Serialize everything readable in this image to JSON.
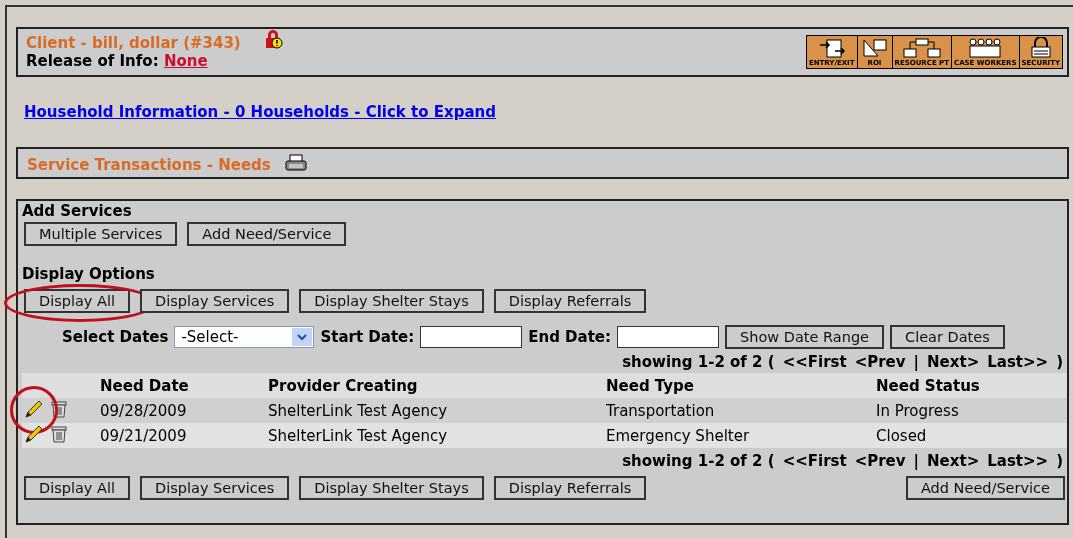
{
  "client": {
    "title": "Client - bill, dollar (#343)",
    "release_label": "Release of Info:",
    "release_value": "None"
  },
  "toolbar": [
    {
      "label": "ENTRY/EXIT",
      "kind": "entry"
    },
    {
      "label": "ROI",
      "kind": "roi"
    },
    {
      "label": "RESOURCE PT",
      "kind": "resource"
    },
    {
      "label": "CASE WORKERS",
      "kind": "workers"
    },
    {
      "label": "SECURITY",
      "kind": "security"
    }
  ],
  "household_link": "Household Information - 0 Households - Click to Expand",
  "section_title": "Service Transactions - Needs",
  "add_services": {
    "heading": "Add Services",
    "buttons": [
      "Multiple Services",
      "Add Need/Service"
    ]
  },
  "display_options": {
    "heading": "Display Options",
    "buttons": [
      {
        "label": "Display All",
        "circled": true
      },
      {
        "label": "Display Services",
        "circled": false
      },
      {
        "label": "Display Shelter Stays",
        "circled": false
      },
      {
        "label": "Display Referrals",
        "circled": false
      }
    ]
  },
  "dates": {
    "select_label": "Select Dates",
    "select_value": "-Select-",
    "start_label": "Start Date:",
    "end_label": "End Date:",
    "buttons": [
      "Show Date Range",
      "Clear Dates"
    ]
  },
  "pagers": [
    {
      "summary": "showing 1-2 of 2 (",
      "links": [
        "<<First",
        "<Prev",
        "Next>",
        "Last>>"
      ],
      "separator": "|",
      "close": ")"
    },
    {
      "summary": "showing 1-2 of 2 (",
      "links": [
        "<<First",
        "<Prev",
        "Next>",
        "Last>>"
      ],
      "separator": "|",
      "close": ")"
    }
  ],
  "table": {
    "columns": [
      "Need Date",
      "Provider Creating",
      "Need Type",
      "Need Status"
    ],
    "rows": [
      {
        "cells": [
          "09/28/2009",
          "ShelterLink Test Agency",
          "Transportation",
          "In Progress"
        ],
        "circled": true
      },
      {
        "cells": [
          "09/21/2009",
          "ShelterLink Test Agency",
          "Emergency Shelter",
          "Closed"
        ],
        "circled": false
      }
    ]
  },
  "bottom_buttons": [
    "Display All",
    "Display Services",
    "Display Shelter Stays",
    "Display Referrals"
  ],
  "bottom_right_button": "Add Need/Service"
}
